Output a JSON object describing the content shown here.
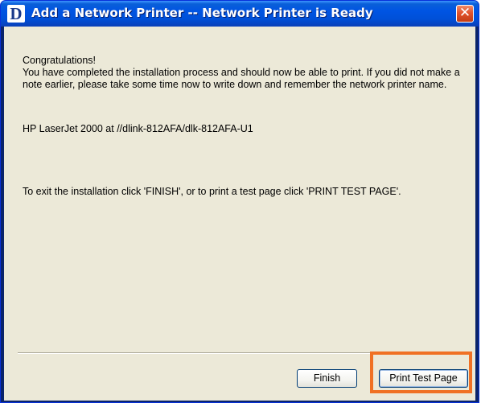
{
  "window": {
    "title": "Add a Network Printer -- Network Printer is Ready",
    "logo_letter": "D",
    "close_glyph": "✕"
  },
  "content": {
    "congrats": "Congratulations!\nYou have completed the installation process and should now be able to print. If you did not make a note earlier, please take some time now to write down and remember the network printer name.",
    "printer_name": "HP LaserJet 2000 at //dlink-812AFA/dlk-812AFA-U1",
    "instructions": "To exit the installation click 'FINISH', or to print a test page click 'PRINT TEST PAGE'."
  },
  "buttons": {
    "finish": "Finish",
    "print_test_page": "Print Test Page"
  },
  "colors": {
    "title_bar": "#0054e3",
    "dialog_bg": "#ece9d8",
    "close_button": "#e2532d",
    "highlight": "#f07124"
  }
}
